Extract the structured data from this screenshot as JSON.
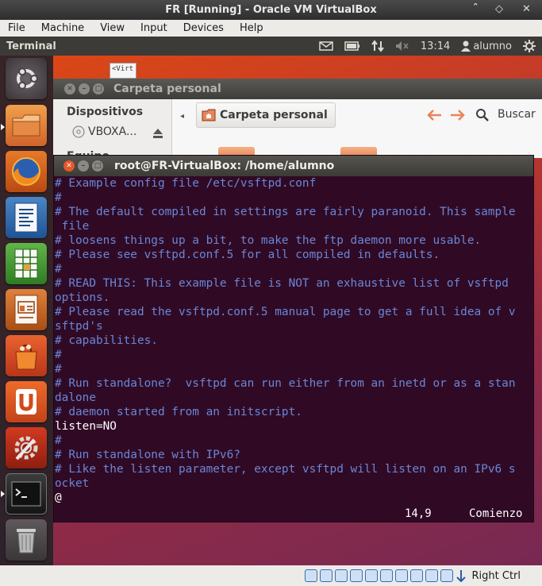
{
  "window": {
    "title": "FR [Running] - Oracle VM VirtualBox",
    "min_glyph": "ˆ",
    "restore_glyph": "◇",
    "close_glyph": "✕"
  },
  "menu": [
    "File",
    "Machine",
    "View",
    "Input",
    "Devices",
    "Help"
  ],
  "topbar": {
    "app_name": "Terminal",
    "time": "13:14",
    "user": "alumno"
  },
  "desktop": {
    "file_label": "<Virt"
  },
  "filemanager": {
    "title": "Carpeta personal",
    "sidebar_heading": "Dispositivos",
    "device": "VBOXA...",
    "partial_heading": "Equipo",
    "location": "Carpeta personal",
    "search": "Buscar"
  },
  "terminal": {
    "title": "root@FR-VirtualBox: /home/alumno",
    "lines": [
      {
        "text": "# Example config file /etc/vsftpd.conf",
        "type": "comment"
      },
      {
        "text": "#",
        "type": "comment"
      },
      {
        "text": "# The default compiled in settings are fairly paranoid. This sample",
        "type": "comment"
      },
      {
        "text": " file",
        "type": "comment"
      },
      {
        "text": "# loosens things up a bit, to make the ftp daemon more usable.",
        "type": "comment"
      },
      {
        "text": "# Please see vsftpd.conf.5 for all compiled in defaults.",
        "type": "comment"
      },
      {
        "text": "#",
        "type": "comment"
      },
      {
        "text": "# READ THIS: This example file is NOT an exhaustive list of vsftpd",
        "type": "comment"
      },
      {
        "text": "options.",
        "type": "comment"
      },
      {
        "text": "# Please read the vsftpd.conf.5 manual page to get a full idea of v",
        "type": "comment"
      },
      {
        "text": "sftpd's",
        "type": "comment"
      },
      {
        "text": "# capabilities.",
        "type": "comment"
      },
      {
        "text": "#",
        "type": "comment"
      },
      {
        "text": "#",
        "type": "comment"
      },
      {
        "text": "# Run standalone?  vsftpd can run either from an inetd or as a stan",
        "type": "comment"
      },
      {
        "text": "dalone",
        "type": "comment"
      },
      {
        "text": "# daemon started from an initscript.",
        "type": "comment"
      },
      {
        "text": "listen=NO",
        "type": "plain"
      },
      {
        "text": "#",
        "type": "comment"
      },
      {
        "text": "# Run standalone with IPv6?",
        "type": "comment"
      },
      {
        "text": "# Like the listen parameter, except vsftpd will listen on an IPv6 s",
        "type": "comment"
      },
      {
        "text": "ocket",
        "type": "comment"
      },
      {
        "text": "@",
        "type": "plain"
      }
    ],
    "cursor_pos": "14,9",
    "scroll_pos": "Comienzo"
  },
  "statusbar": {
    "host_key": "Right Ctrl"
  },
  "colors": {
    "terminal_bg": "#300a24",
    "comment": "#6a86d8",
    "launcher_bg": "#2b2329",
    "topbar_bg": "#3c3b37"
  }
}
